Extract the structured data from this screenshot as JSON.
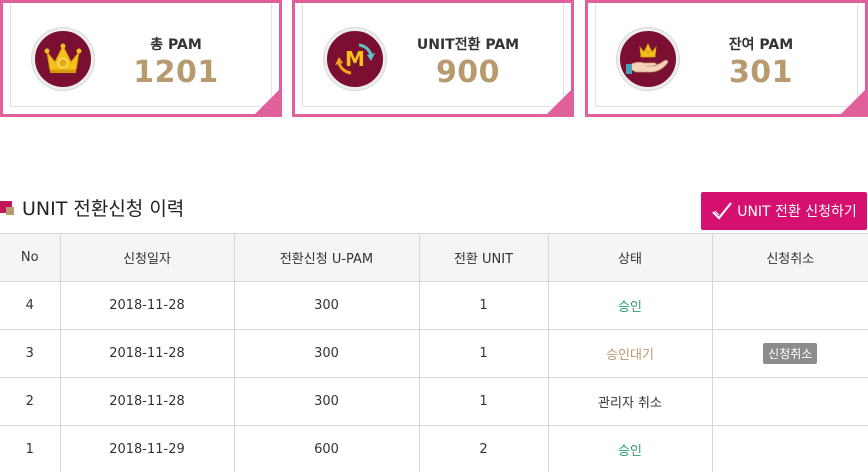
{
  "summary": {
    "total": {
      "label": "총 PAM",
      "value": "1201",
      "icon": "crown-icon"
    },
    "unit": {
      "label": "UNIT전환 PAM",
      "value": "900",
      "icon": "m-exchange-icon"
    },
    "remain": {
      "label": "잔여 PAM",
      "value": "301",
      "icon": "hand-crown-icon"
    }
  },
  "section": {
    "title": "UNIT 전환신청 이력",
    "apply_button": "UNIT 전환 신청하기"
  },
  "table": {
    "headers": [
      "No",
      "신청일자",
      "전환신청 U-PAM",
      "전환 UNIT",
      "상태",
      "신청취소"
    ],
    "rows": [
      {
        "no": "4",
        "date": "2018-11-28",
        "upam": "300",
        "unit": "1",
        "status": "승인",
        "cancel": ""
      },
      {
        "no": "3",
        "date": "2018-11-28",
        "upam": "300",
        "unit": "1",
        "status": "승인대기",
        "cancel": "신청취소"
      },
      {
        "no": "2",
        "date": "2018-11-28",
        "upam": "300",
        "unit": "1",
        "status": "관리자 취소",
        "cancel": ""
      },
      {
        "no": "1",
        "date": "2018-11-29",
        "upam": "600",
        "unit": "2",
        "status": "승인",
        "cancel": ""
      }
    ]
  },
  "colors": {
    "accent_pink": "#e0609c",
    "button_pink": "#d6106f",
    "icon_bg": "#7a0f32",
    "gold": "#b79a6e",
    "approved_green": "#2fa36b"
  }
}
